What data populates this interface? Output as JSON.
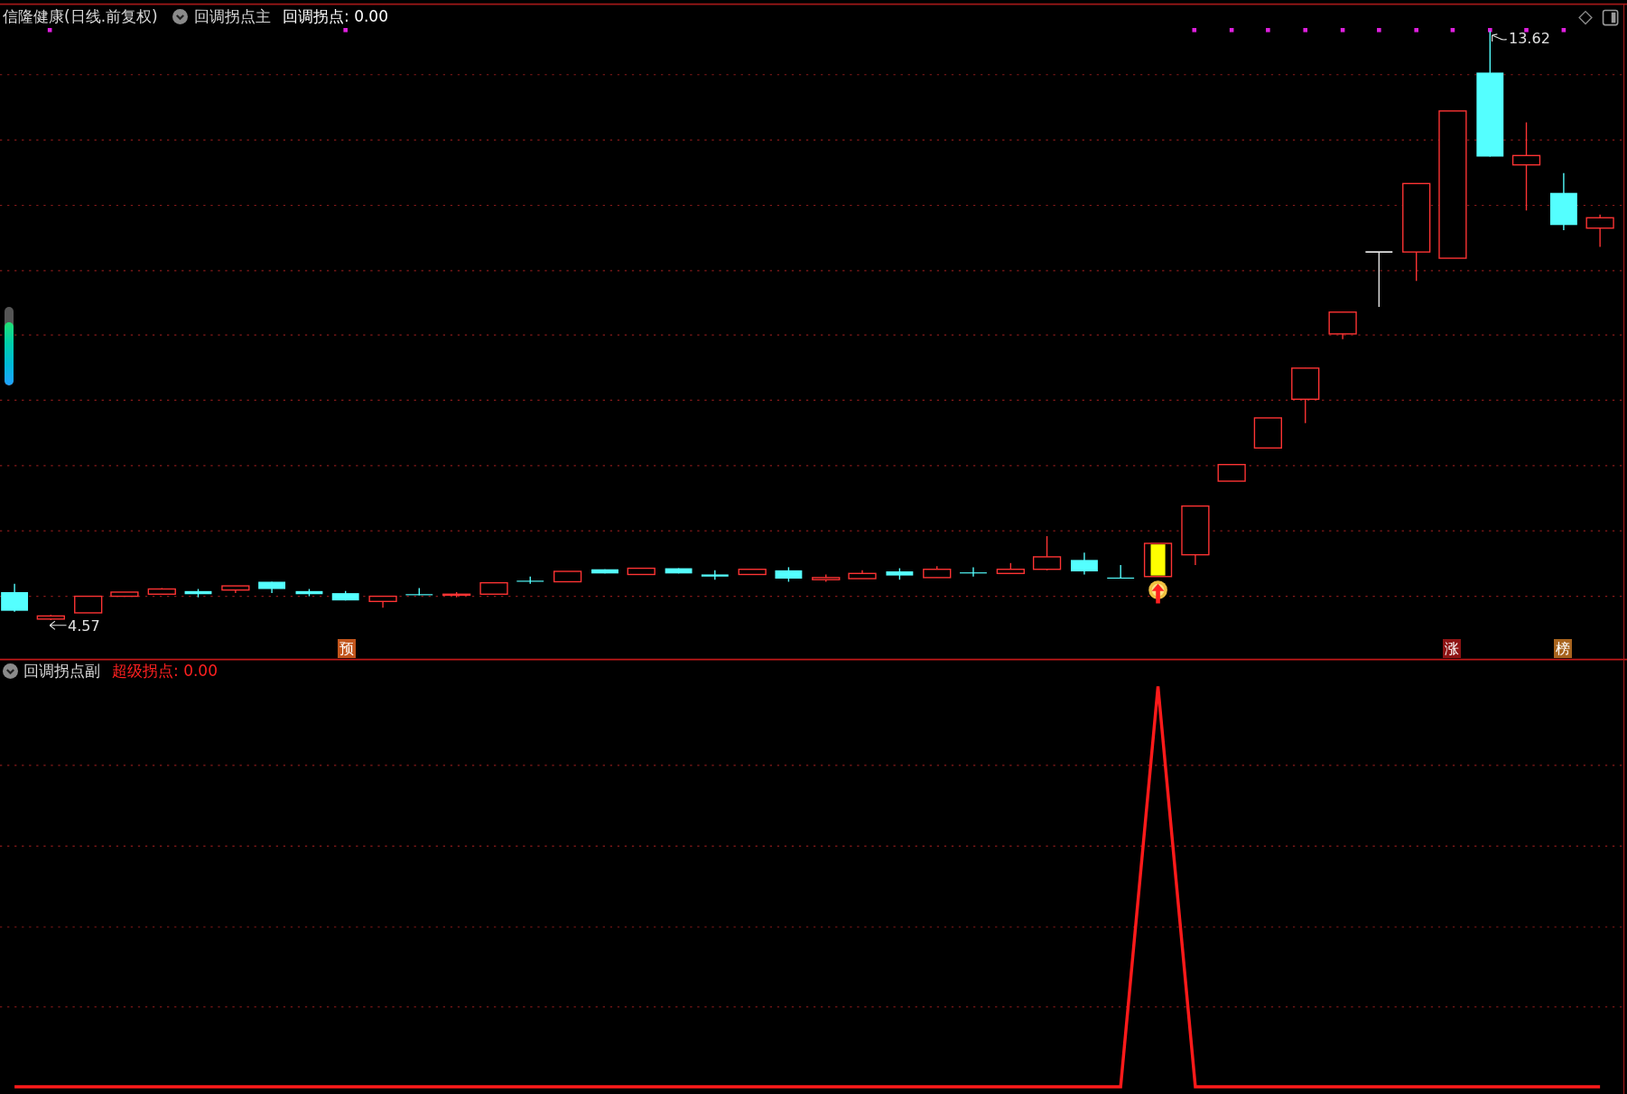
{
  "main_panel": {
    "stock_title": "信隆健康(日线.前复权)",
    "indicator_name": "回调拐点主",
    "indicator_value": "回调拐点: 0.00",
    "low_label": "4.57",
    "high_label": "13.62",
    "meter": {
      "level": 0.8
    },
    "markers": [
      {
        "text": "预",
        "color": "#c2551c"
      },
      {
        "text": "涨",
        "color": "#8e1414"
      },
      {
        "text": "榜",
        "color": "#a8641e"
      }
    ]
  },
  "sub_panel": {
    "indicator_name": "回调拐点副",
    "indicator_value": "超级拐点: 0.00"
  }
}
